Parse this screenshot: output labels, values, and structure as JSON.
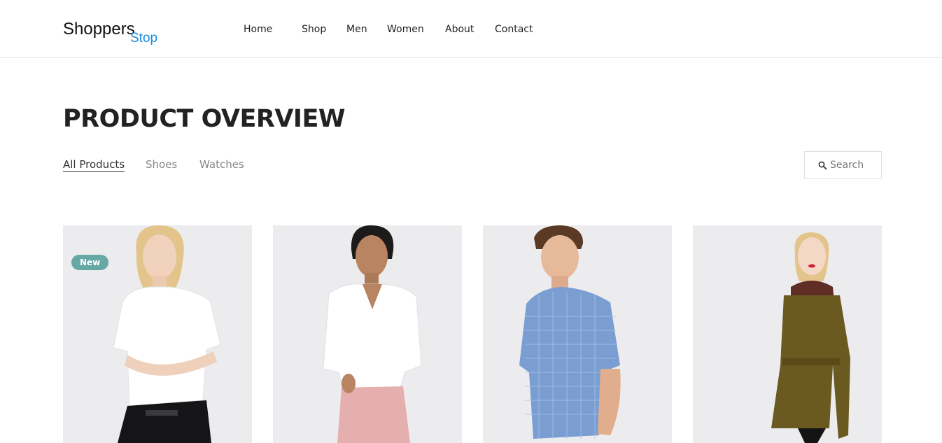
{
  "logo": {
    "main": "Shoppers",
    "sub": "Stop",
    "sub_color": "#1e8cdb"
  },
  "nav": {
    "items": [
      {
        "label": "Home"
      },
      {
        "label": "Shop"
      },
      {
        "label": "Men"
      },
      {
        "label": "Women"
      },
      {
        "label": "About"
      },
      {
        "label": "Contact"
      }
    ]
  },
  "page": {
    "title": "PRODUCT OVERVIEW"
  },
  "filters": {
    "items": [
      {
        "label": "All Products",
        "active": true
      },
      {
        "label": "Shoes",
        "active": false
      },
      {
        "label": "Watches",
        "active": false
      }
    ]
  },
  "search": {
    "label": "Search",
    "icon": "search-icon"
  },
  "products": [
    {
      "badge": "New",
      "image": "woman in white t-shirt and black jeans"
    },
    {
      "image": "woman in white shirt and pink trousers"
    },
    {
      "image": "man in blue checked short-sleeve shirt"
    },
    {
      "image": "woman in olive coat with fur collar"
    }
  ],
  "colors": {
    "badge": "#66a8a6",
    "card_bg": "#ecedf0",
    "accent": "#1e8cdb"
  }
}
